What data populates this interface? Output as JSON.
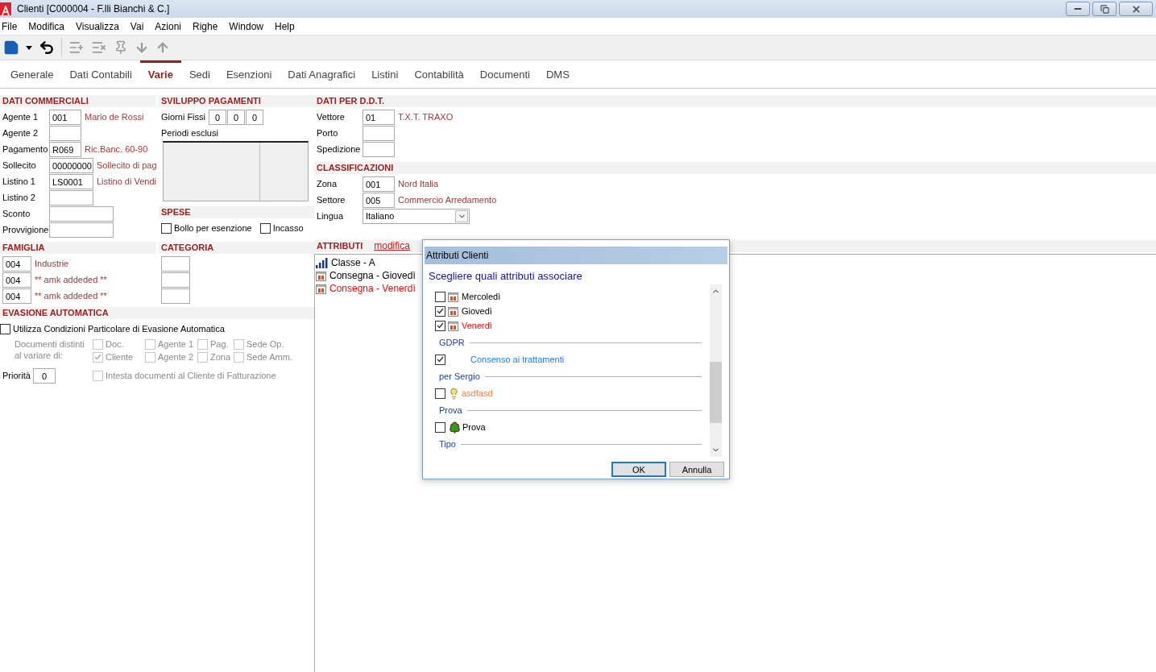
{
  "window": {
    "title": "Clienti [C000004 - F.lli Bianchi & C.]"
  },
  "menu": [
    "File",
    "Modifica",
    "Visualizza",
    "Vai",
    "Azioni",
    "Righe",
    "Window",
    "Help"
  ],
  "toolbar": [
    {
      "disabled": false
    },
    {
      "disabled": false
    },
    {
      "disabled": false
    },
    {
      "disabled": true
    },
    {
      "disabled": true
    },
    {
      "disabled": true
    },
    {
      "disabled": true
    },
    {
      "disabled": true
    }
  ],
  "tabs": [
    {
      "label": "Generale",
      "selected": false
    },
    {
      "label": "Dati Contabili",
      "selected": false
    },
    {
      "label": "Varie",
      "selected": true
    },
    {
      "label": "Sedi",
      "selected": false
    },
    {
      "label": "Esenzioni",
      "selected": false
    },
    {
      "label": "Dati Anagrafici",
      "selected": false
    },
    {
      "label": "Listini",
      "selected": false
    },
    {
      "label": "Contabilità",
      "selected": false
    },
    {
      "label": "Documenti",
      "selected": false
    },
    {
      "label": "DMS",
      "selected": false
    }
  ],
  "dati_commerciali": {
    "title": "DATI COMMERCIALI",
    "fields": [
      {
        "label": "Agente 1",
        "value": "001",
        "description": "Mario de Rossi",
        "kind": "short"
      },
      {
        "label": "Agente 2",
        "kind": "short"
      },
      {
        "label": "Pagamento",
        "value": "R069",
        "description": "Ric.Banc. 60-90",
        "kind": "short"
      },
      {
        "label": "Sollecito",
        "value": "00000000",
        "description": "Sollecito di pag",
        "kind": "medium"
      },
      {
        "label": "Listino 1",
        "value": "LS0001",
        "description": "Listino di Vendi",
        "kind": "medium"
      },
      {
        "label": "Listino 2",
        "kind": "medium"
      },
      {
        "label": "Sconto",
        "kind": "long"
      },
      {
        "label": "Provvigione",
        "kind": "long"
      }
    ]
  },
  "sviluppo_pagamenti": {
    "title": "SVILUPPO PAGAMENTI",
    "giorni_fissi_label": "Giorni Fissi",
    "giorni_fissi": [
      "0",
      "0",
      "0"
    ],
    "periodi_label": "Periodi esclusi"
  },
  "spese": {
    "title": "SPESE",
    "options": [
      {
        "label": "Bollo per esenzione",
        "checked": false
      },
      {
        "label": "Incasso",
        "checked": false
      }
    ]
  },
  "dati_ddt": {
    "title": "DATI PER D.D.T.",
    "fields": [
      {
        "label": "Vettore",
        "value": "01",
        "description": "T.X.T. TRAXO"
      },
      {
        "label": "Porto"
      },
      {
        "label": "Spedizione"
      }
    ]
  },
  "classificazioni": {
    "title": "CLASSIFICAZIONI",
    "fields": [
      {
        "label": "Zona",
        "value": "001",
        "description": "Nord Italia"
      },
      {
        "label": "Settore",
        "value": "005",
        "description": "Commercio Arredamento"
      }
    ],
    "lingua": {
      "label": "Lingua",
      "value": "Italiano"
    }
  },
  "famiglia": {
    "title": "FAMIGLIA",
    "rows": [
      {
        "code": "004",
        "description": "Industrie"
      },
      {
        "code": "004",
        "description": "** amk addeded **"
      },
      {
        "code": "004",
        "description": "** amk addeded **"
      }
    ]
  },
  "categoria": {
    "title": "CATEGORIA"
  },
  "evasione": {
    "title": "EVASIONE AUTOMATICA",
    "main": {
      "label": "Utilizza Condizioni Particolare di Evasione Automatica",
      "checked": false
    },
    "documenti_label": [
      "Documenti distinti",
      "al variare di:"
    ],
    "options": [
      {
        "label": "Doc.",
        "checked": false,
        "disabled": true
      },
      {
        "label": "Agente 1",
        "checked": false,
        "disabled": true
      },
      {
        "label": "Pag.",
        "checked": false,
        "disabled": true
      },
      {
        "label": "Sede Op.",
        "checked": false,
        "disabled": true
      },
      {
        "label": "Cliente",
        "checked": true,
        "disabled": true
      },
      {
        "label": "Agente 2",
        "checked": false,
        "disabled": true
      },
      {
        "label": "Zona",
        "checked": false,
        "disabled": true
      },
      {
        "label": "Sede Amm.",
        "checked": false,
        "disabled": true
      }
    ],
    "priorita_label": "Priorità",
    "priorita": "0",
    "intesta": {
      "label": "Intesta documenti al Cliente di Fatturazione",
      "checked": false,
      "disabled": true
    }
  },
  "attributi": {
    "title": "ATTRIBUTI",
    "link": "modifica",
    "items": [
      {
        "label": "Classe - A",
        "kind": "bars",
        "color": "#000000"
      },
      {
        "label": "Consegna - Giovedì",
        "kind": "calendar",
        "color": "#000000"
      },
      {
        "label": "Consegna - Venerdì",
        "kind": "calendar",
        "color": "#ff0000"
      }
    ]
  },
  "dialog": {
    "title": "Attributi Clienti",
    "prompt": "Scegliere quali attributi associare",
    "items": [
      {
        "kind": "calendar",
        "label": "Mercoledì",
        "checked": false,
        "color": "#000000"
      },
      {
        "kind": "calendar",
        "label": "Giovedì",
        "checked": true,
        "color": "#000000"
      },
      {
        "kind": "calendar",
        "label": "Venerdì",
        "checked": true,
        "color": "#ff0000"
      },
      {
        "kind": "group",
        "label": "GDPR"
      },
      {
        "kind": "plain",
        "label": "Consenso ai trattamenti",
        "checked": true,
        "color": "#1e7bff"
      },
      {
        "kind": "group",
        "label": "per Sergio"
      },
      {
        "kind": "bulb",
        "label": "asdfasd",
        "checked": false,
        "color": "#f0804a"
      },
      {
        "kind": "group",
        "label": "Prova"
      },
      {
        "kind": "tree",
        "label": "Prova",
        "checked": false,
        "color": "#000000"
      },
      {
        "kind": "group",
        "label": "Tipo"
      }
    ],
    "buttons": [
      {
        "label": "OK",
        "default": true
      },
      {
        "label": "Annulla",
        "default": false
      }
    ]
  }
}
